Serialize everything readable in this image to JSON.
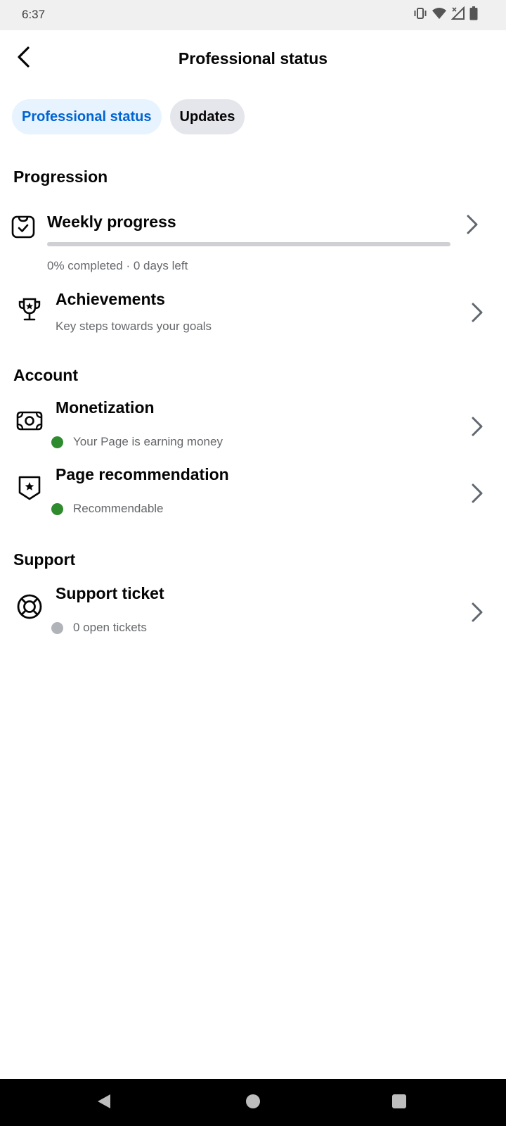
{
  "status_bar": {
    "time": "6:37",
    "icons": [
      "vibrate-icon",
      "wifi-icon",
      "signal-icon",
      "battery-icon"
    ]
  },
  "header": {
    "title": "Professional status",
    "back_icon": "back-arrow-icon"
  },
  "tabs": [
    {
      "label": "Professional status",
      "active": true
    },
    {
      "label": "Updates",
      "active": false
    }
  ],
  "sections": {
    "progression": "Progression",
    "account": "Account",
    "support": "Support"
  },
  "weekly_progress": {
    "title": "Weekly progress",
    "percent": 0,
    "detail": "0% completed · 0 days left"
  },
  "achievements": {
    "title": "Achievements",
    "subtitle": "Key steps towards your goals"
  },
  "monetization": {
    "title": "Monetization",
    "status": "Your Page is earning money",
    "status_color": "#2e8b2e"
  },
  "page_recommendation": {
    "title": "Page recommendation",
    "status": "Recommendable",
    "status_color": "#2e8b2e"
  },
  "support_ticket": {
    "title": "Support ticket",
    "status": "0 open tickets",
    "status_color": "#b0b3b8"
  },
  "colors": {
    "accent": "#0064d1",
    "active_tab_bg": "#e7f3ff",
    "inactive_tab_bg": "#e4e6eb"
  },
  "nav_bar": {
    "icons": [
      "nav-back-icon",
      "nav-home-icon",
      "nav-recents-icon"
    ]
  }
}
